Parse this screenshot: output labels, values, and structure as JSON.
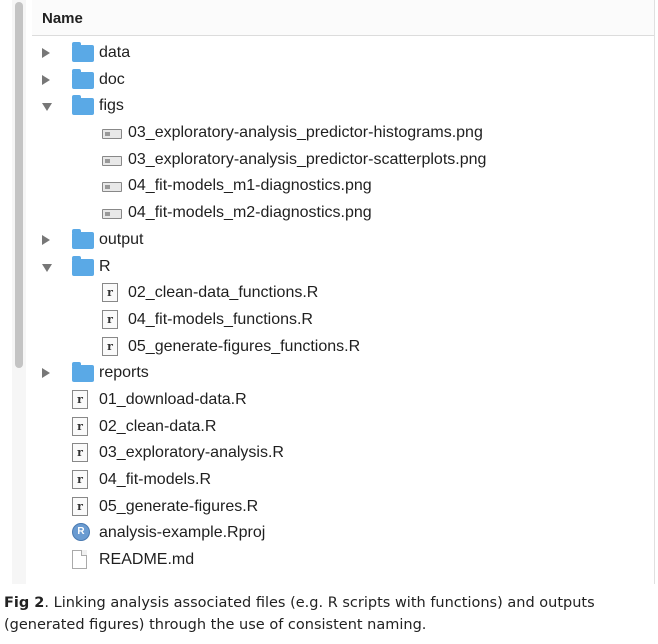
{
  "header": {
    "name_column": "Name"
  },
  "items": [
    {
      "label": "data",
      "type": "folder",
      "state": "collapsed",
      "level": 0
    },
    {
      "label": "doc",
      "type": "folder",
      "state": "collapsed",
      "level": 0
    },
    {
      "label": "figs",
      "type": "folder",
      "state": "expanded",
      "level": 0
    },
    {
      "label": "03_exploratory-analysis_predictor-histograms.png",
      "type": "png",
      "level": 1
    },
    {
      "label": "03_exploratory-analysis_predictor-scatterplots.png",
      "type": "png",
      "level": 1
    },
    {
      "label": "04_fit-models_m1-diagnostics.png",
      "type": "png",
      "level": 1
    },
    {
      "label": "04_fit-models_m2-diagnostics.png",
      "type": "png",
      "level": 1
    },
    {
      "label": "output",
      "type": "folder",
      "state": "collapsed",
      "level": 0
    },
    {
      "label": "R",
      "type": "folder",
      "state": "expanded",
      "level": 0
    },
    {
      "label": "02_clean-data_functions.R",
      "type": "r",
      "level": 1
    },
    {
      "label": "04_fit-models_functions.R",
      "type": "r",
      "level": 1
    },
    {
      "label": "05_generate-figures_functions.R",
      "type": "r",
      "level": 1
    },
    {
      "label": "reports",
      "type": "folder",
      "state": "collapsed",
      "level": 0
    },
    {
      "label": "01_download-data.R",
      "type": "r",
      "level": 0
    },
    {
      "label": "02_clean-data.R",
      "type": "r",
      "level": 0
    },
    {
      "label": "03_exploratory-analysis.R",
      "type": "r",
      "level": 0
    },
    {
      "label": "04_fit-models.R",
      "type": "r",
      "level": 0
    },
    {
      "label": "05_generate-figures.R",
      "type": "r",
      "level": 0
    },
    {
      "label": "analysis-example.Rproj",
      "type": "rproj",
      "level": 0
    },
    {
      "label": "README.md",
      "type": "md",
      "level": 0
    }
  ],
  "icon_glyphs": {
    "r": "r",
    "rproj": "R"
  },
  "caption": {
    "label": "Fig 2",
    "text": ". Linking analysis associated files (e.g. R scripts with functions) and outputs (generated figures) through the use of consistent naming."
  },
  "colors": {
    "folder": "#5aa9e6",
    "scroll_thumb": "#c4c4c4"
  }
}
